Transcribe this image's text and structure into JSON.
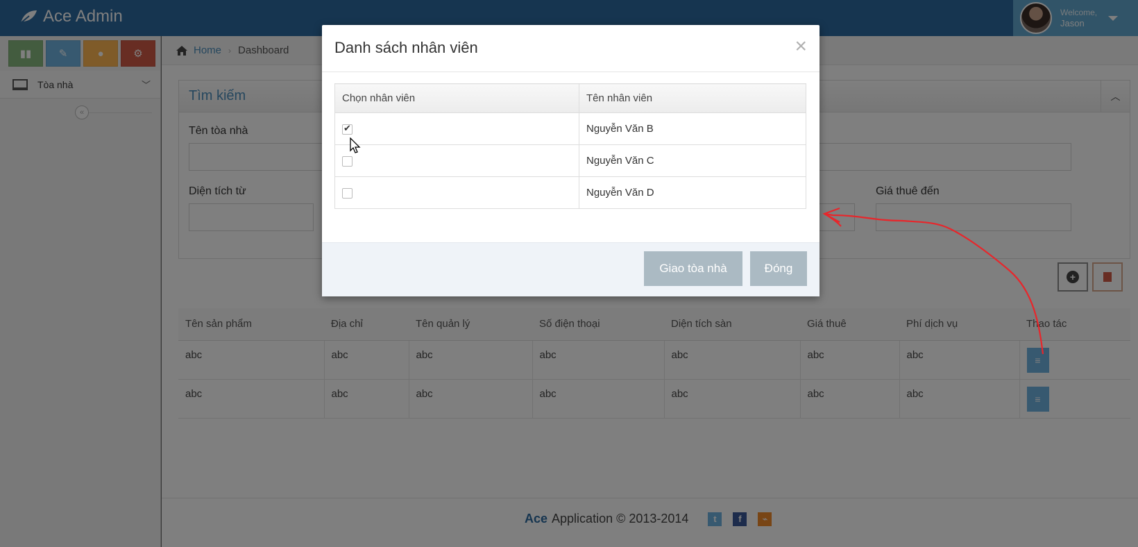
{
  "navbar": {
    "brand": "Ace Admin",
    "welcome": "Welcome,",
    "user": "Jason"
  },
  "sidebar": {
    "shortcut_icons": [
      "signal-icon",
      "pencil-icon",
      "users-icon",
      "cogs-icon"
    ],
    "menu": [
      {
        "label": "Tòa nhà",
        "icon": "desktop-icon"
      }
    ]
  },
  "breadcrumb": {
    "home": "Home",
    "current": "Dashboard"
  },
  "search": {
    "title": "Tìm kiếm",
    "fields": {
      "building_name_label": "Tên tòa nhà",
      "area_from_label": "Diện tích từ",
      "rent_to_label": "Giá thuê đến"
    }
  },
  "table": {
    "headers": [
      "Tên sản phẩm",
      "Địa chỉ",
      "Tên quản lý",
      "Số điện thoại",
      "Diện tích sàn",
      "Giá thuê",
      "Phí dịch vụ",
      "Thao tác"
    ],
    "rows": [
      [
        "abc",
        "abc",
        "abc",
        "abc",
        "abc",
        "abc",
        "abc"
      ],
      [
        "abc",
        "abc",
        "abc",
        "abc",
        "abc",
        "abc",
        "abc"
      ]
    ]
  },
  "footer": {
    "brand": "Ace",
    "text": "Application © 2013-2014"
  },
  "modal": {
    "title": "Danh sách nhân viên",
    "close_symbol": "×",
    "headers": [
      "Chọn nhân viên",
      "Tên nhân viên"
    ],
    "employees": [
      {
        "name": "Nguyễn Văn B",
        "checked": true
      },
      {
        "name": "Nguyễn Văn C",
        "checked": false
      },
      {
        "name": "Nguyễn Văn D",
        "checked": false
      }
    ],
    "assign_button": "Giao tòa nhà",
    "close_button": "Đóng"
  },
  "colors": {
    "navbar": "#2c6aa0",
    "user_area": "#62a8d1",
    "annotation_arrow": "#e8262b",
    "modal_button": "#abbac3"
  }
}
